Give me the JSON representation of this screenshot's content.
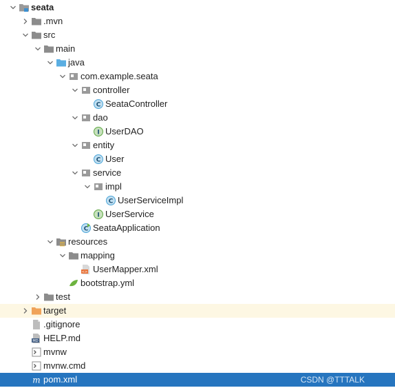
{
  "tree": [
    {
      "label": "seata",
      "depth": 0,
      "expanded": true,
      "icon": "module-folder-icon",
      "bold": true
    },
    {
      "label": ".mvn",
      "depth": 1,
      "expanded": false,
      "icon": "folder-icon"
    },
    {
      "label": "src",
      "depth": 1,
      "expanded": true,
      "icon": "folder-icon"
    },
    {
      "label": "main",
      "depth": 2,
      "expanded": true,
      "icon": "folder-icon"
    },
    {
      "label": "java",
      "depth": 3,
      "expanded": true,
      "icon": "source-folder-icon"
    },
    {
      "label": "com.example.seata",
      "depth": 4,
      "expanded": true,
      "icon": "package-icon"
    },
    {
      "label": "controller",
      "depth": 5,
      "expanded": true,
      "icon": "package-icon"
    },
    {
      "label": "SeataController",
      "depth": 6,
      "icon": "class-icon",
      "badge": "C"
    },
    {
      "label": "dao",
      "depth": 5,
      "expanded": true,
      "icon": "package-icon"
    },
    {
      "label": "UserDAO",
      "depth": 6,
      "icon": "interface-icon",
      "badge": "I"
    },
    {
      "label": "entity",
      "depth": 5,
      "expanded": true,
      "icon": "package-icon"
    },
    {
      "label": "User",
      "depth": 6,
      "icon": "class-icon",
      "badge": "C"
    },
    {
      "label": "service",
      "depth": 5,
      "expanded": true,
      "icon": "package-icon"
    },
    {
      "label": "impl",
      "depth": 6,
      "expanded": true,
      "icon": "package-icon"
    },
    {
      "label": "UserServiceImpl",
      "depth": 7,
      "icon": "class-icon",
      "badge": "C"
    },
    {
      "label": "UserService",
      "depth": 6,
      "icon": "interface-icon",
      "badge": "I"
    },
    {
      "label": "SeataApplication",
      "depth": 5,
      "icon": "spring-boot-class-icon",
      "badge": "C"
    },
    {
      "label": "resources",
      "depth": 3,
      "expanded": true,
      "icon": "resources-folder-icon"
    },
    {
      "label": "mapping",
      "depth": 4,
      "expanded": true,
      "icon": "folder-icon"
    },
    {
      "label": "UserMapper.xml",
      "depth": 5,
      "icon": "xml-file-icon"
    },
    {
      "label": "bootstrap.yml",
      "depth": 4,
      "icon": "yaml-file-icon"
    },
    {
      "label": "test",
      "depth": 2,
      "expanded": false,
      "icon": "folder-icon"
    },
    {
      "label": "target",
      "depth": 1,
      "expanded": false,
      "icon": "excluded-folder-icon",
      "highlight": true
    },
    {
      "label": ".gitignore",
      "depth": 1,
      "icon": "text-file-icon"
    },
    {
      "label": "HELP.md",
      "depth": 1,
      "icon": "markdown-file-icon"
    },
    {
      "label": "mvnw",
      "depth": 1,
      "icon": "shell-file-icon"
    },
    {
      "label": "mvnw.cmd",
      "depth": 1,
      "icon": "cmd-file-icon"
    },
    {
      "label": "pom.xml",
      "depth": 1,
      "icon": "maven-file-icon",
      "selected": true
    }
  ],
  "watermark": "CSDN @TTTALK",
  "colors": {
    "selected_bg": "#2675bf",
    "highlight_bg": "#fdf7e3",
    "class_icon": "#4aa4d8",
    "interface_icon": "#5fa843",
    "folder": "#8c8c8c",
    "source_folder": "#5aaee2",
    "excluded_folder": "#f0a35a"
  }
}
